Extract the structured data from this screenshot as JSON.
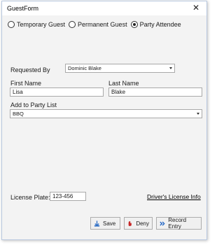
{
  "window": {
    "title": "GuestForm",
    "close_glyph": "✕"
  },
  "guest_type": {
    "options": [
      {
        "label": "Temporary Guest",
        "selected": false
      },
      {
        "label": "Permanent Guest",
        "selected": false
      },
      {
        "label": "Party Attendee",
        "selected": true
      }
    ]
  },
  "form": {
    "requested_by_label": "Requested By",
    "requested_by_value": "Dominic Blake",
    "first_name_label": "First Name",
    "first_name_value": "Lisa",
    "last_name_label": "Last Name",
    "last_name_value": "Blake",
    "party_list_label": "Add to Party List",
    "party_list_value": "BBQ",
    "license_plate_label": "License Plate:",
    "license_plate_value": "123-456",
    "drivers_license_link": "Driver's License Info"
  },
  "buttons": {
    "save": "Save",
    "deny": "Deny",
    "record": "Record Entry"
  },
  "icons": {
    "save": "save-icon",
    "deny": "deny-icon",
    "record": "record-entry-icon"
  }
}
